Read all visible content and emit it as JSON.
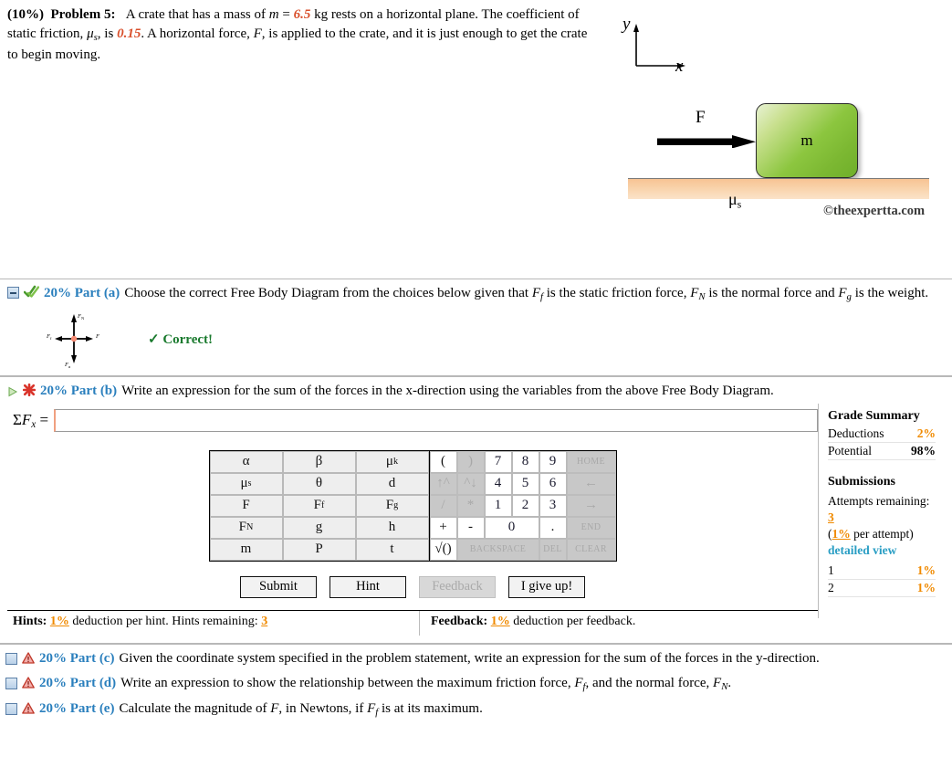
{
  "problem": {
    "weight": "(10%)",
    "label": "Problem 5:",
    "line1_a": "A crate that has a mass of ",
    "mass_var": "m",
    "eq": " = ",
    "mass_value": "6.5",
    "line1_b": " kg rests on a horizontal plane. The",
    "line2_a": "coefficient of static friction, ",
    "mu_sym": "μ",
    "mu_sub": "s",
    "line2_b": ", is ",
    "mu_value": "0.15",
    "line2_c": ". A horizontal force, ",
    "force_var": "F",
    "line2_d": ", is applied to the crate, and it is just",
    "line3": "enough to get the crate to begin moving."
  },
  "figure": {
    "y_axis_label": "y",
    "x_axis_label": "x",
    "force_label": "F",
    "crate_label": "m",
    "mu_label": "μ",
    "mu_label_sub": "s",
    "watermark": "©theexpertta.com",
    "crate_color": "#8cc63f",
    "ground_color": "#f7c393"
  },
  "parts": {
    "a": {
      "title": "20% Part (a)",
      "text_1": "Choose the correct Free Body Diagram from the choices below given that ",
      "var_ff": "F",
      "var_ff_sub": "f",
      "text_2": " is the static friction force, ",
      "var_fn": "F",
      "var_fn_sub": "N",
      "text_3": " is the normal force and ",
      "var_fg": "F",
      "var_fg_sub": "g",
      "text_4": " is",
      "text_5": "the weight.",
      "status": "✓ Correct!",
      "fbd": {
        "up_label": "F",
        "up_sub": "N",
        "left_label": "F",
        "left_sub": "f",
        "right_label": "F",
        "down_label": "F",
        "down_sub": "g"
      }
    },
    "b": {
      "title": "20% Part (b)",
      "text": "Write an expression for the sum of the forces in the x-direction using the variables from the above Free Body Diagram.",
      "answer_label_sigma": "Σ",
      "answer_label_f": "F",
      "answer_label_sub": "x",
      "answer_label_eq": " =",
      "answer_value": "",
      "answer_placeholder": ""
    },
    "c": {
      "title": "20% Part (c)",
      "text": "Given the coordinate system specified in the problem statement, write an expression for the sum of the forces in the y-direction."
    },
    "d": {
      "title": "20% Part (d)",
      "text_1": "Write an expression to show the relationship between the maximum friction force, ",
      "var_ff": "F",
      "var_ff_sub": "f",
      "text_2": ", and the normal force, ",
      "var_fn": "F",
      "var_fn_sub": "N",
      "text_3": "."
    },
    "e": {
      "title": "20% Part (e)",
      "text_1": "Calculate the magnitude of ",
      "var_f": "F",
      "text_2": ", in Newtons, if ",
      "var_ff": "F",
      "var_ff_sub": "f",
      "text_3": " is at its maximum."
    }
  },
  "keypad": {
    "variables": [
      [
        "α",
        "β",
        "μk"
      ],
      [
        "μs",
        "θ",
        "d"
      ],
      [
        "F",
        "Ff",
        "Fg"
      ],
      [
        "FN",
        "g",
        "h"
      ],
      [
        "m",
        "P",
        "t"
      ]
    ],
    "var_rows": [
      [
        {
          "base": "α",
          "sub": ""
        },
        {
          "base": "β",
          "sub": ""
        },
        {
          "base": "μ",
          "sub": "k"
        }
      ],
      [
        {
          "base": "μ",
          "sub": "s"
        },
        {
          "base": "θ",
          "sub": ""
        },
        {
          "base": "d",
          "sub": ""
        }
      ],
      [
        {
          "base": "F",
          "sub": ""
        },
        {
          "base": "F",
          "sub": "f"
        },
        {
          "base": "F",
          "sub": "g"
        }
      ],
      [
        {
          "base": "F",
          "sub": "N"
        },
        {
          "base": "g",
          "sub": ""
        },
        {
          "base": "h",
          "sub": ""
        }
      ],
      [
        {
          "base": "m",
          "sub": ""
        },
        {
          "base": "P",
          "sub": ""
        },
        {
          "base": "t",
          "sub": ""
        }
      ]
    ],
    "calc_rows": [
      [
        {
          "label": "(",
          "disabled": false,
          "w": "n"
        },
        {
          "label": ")",
          "disabled": true,
          "w": "n"
        },
        {
          "label": "7",
          "disabled": false,
          "w": "n",
          "num": true
        },
        {
          "label": "8",
          "disabled": false,
          "w": "n",
          "num": true
        },
        {
          "label": "9",
          "disabled": false,
          "w": "n",
          "num": true
        },
        {
          "label": "HOME",
          "disabled": true,
          "w": "home",
          "small": true
        }
      ],
      [
        {
          "label": "↑^",
          "disabled": true,
          "w": "n"
        },
        {
          "label": "^↓",
          "disabled": true,
          "w": "n"
        },
        {
          "label": "4",
          "disabled": false,
          "w": "n",
          "num": true
        },
        {
          "label": "5",
          "disabled": false,
          "w": "n",
          "num": true
        },
        {
          "label": "6",
          "disabled": false,
          "w": "n",
          "num": true
        },
        {
          "label": "←",
          "disabled": true,
          "w": "home"
        }
      ],
      [
        {
          "label": "/",
          "disabled": true,
          "w": "n"
        },
        {
          "label": "*",
          "disabled": true,
          "w": "n"
        },
        {
          "label": "1",
          "disabled": false,
          "w": "n",
          "num": true
        },
        {
          "label": "2",
          "disabled": false,
          "w": "n",
          "num": true
        },
        {
          "label": "3",
          "disabled": false,
          "w": "n",
          "num": true
        },
        {
          "label": "→",
          "disabled": true,
          "w": "home"
        }
      ],
      [
        {
          "label": "+",
          "disabled": false,
          "w": "n"
        },
        {
          "label": "-",
          "disabled": false,
          "w": "n"
        },
        {
          "label": "0",
          "disabled": false,
          "w": "wide",
          "num": true
        },
        {
          "label": ".",
          "disabled": false,
          "w": "n"
        },
        {
          "label": "END",
          "disabled": true,
          "w": "home",
          "small": true
        }
      ],
      [
        {
          "label": "√()",
          "disabled": false,
          "w": "n"
        },
        {
          "label": "BACKSPACE",
          "disabled": true,
          "w": "bksp",
          "small": true
        },
        {
          "label": "DEL",
          "disabled": true,
          "w": "n",
          "small": true
        },
        {
          "label": "CLEAR",
          "disabled": true,
          "w": "home",
          "small": true
        }
      ]
    ]
  },
  "actions": {
    "submit": "Submit",
    "hint": "Hint",
    "feedback": "Feedback",
    "give_up": "I give up!"
  },
  "hints_bar": {
    "hints_label": "Hints:",
    "hints_pct": "1%",
    "hints_text": " deduction per hint. Hints remaining: ",
    "hints_remaining": "3",
    "feedback_label": "Feedback:",
    "feedback_pct": "1%",
    "feedback_text": " deduction per feedback."
  },
  "grade_summary": {
    "title": "Grade Summary",
    "deductions_label": "Deductions",
    "deductions_value": "2%",
    "potential_label": "Potential",
    "potential_value": "98%",
    "submissions_title": "Submissions",
    "attempts_label": "Attempts remaining: ",
    "attempts_value": "3",
    "per_attempt_open": "(",
    "per_attempt_pct": "1%",
    "per_attempt_text": " per attempt)",
    "detailed_view": "detailed view",
    "rows": [
      {
        "n": "1",
        "pct": "1%"
      },
      {
        "n": "2",
        "pct": "1%"
      }
    ]
  },
  "colors": {
    "accent_blue": "#2a7fbd",
    "orange": "#f08a00",
    "correct_green": "#1a7a2e",
    "value_red": "#d94f2b",
    "link_blue": "#2a9ec4"
  }
}
